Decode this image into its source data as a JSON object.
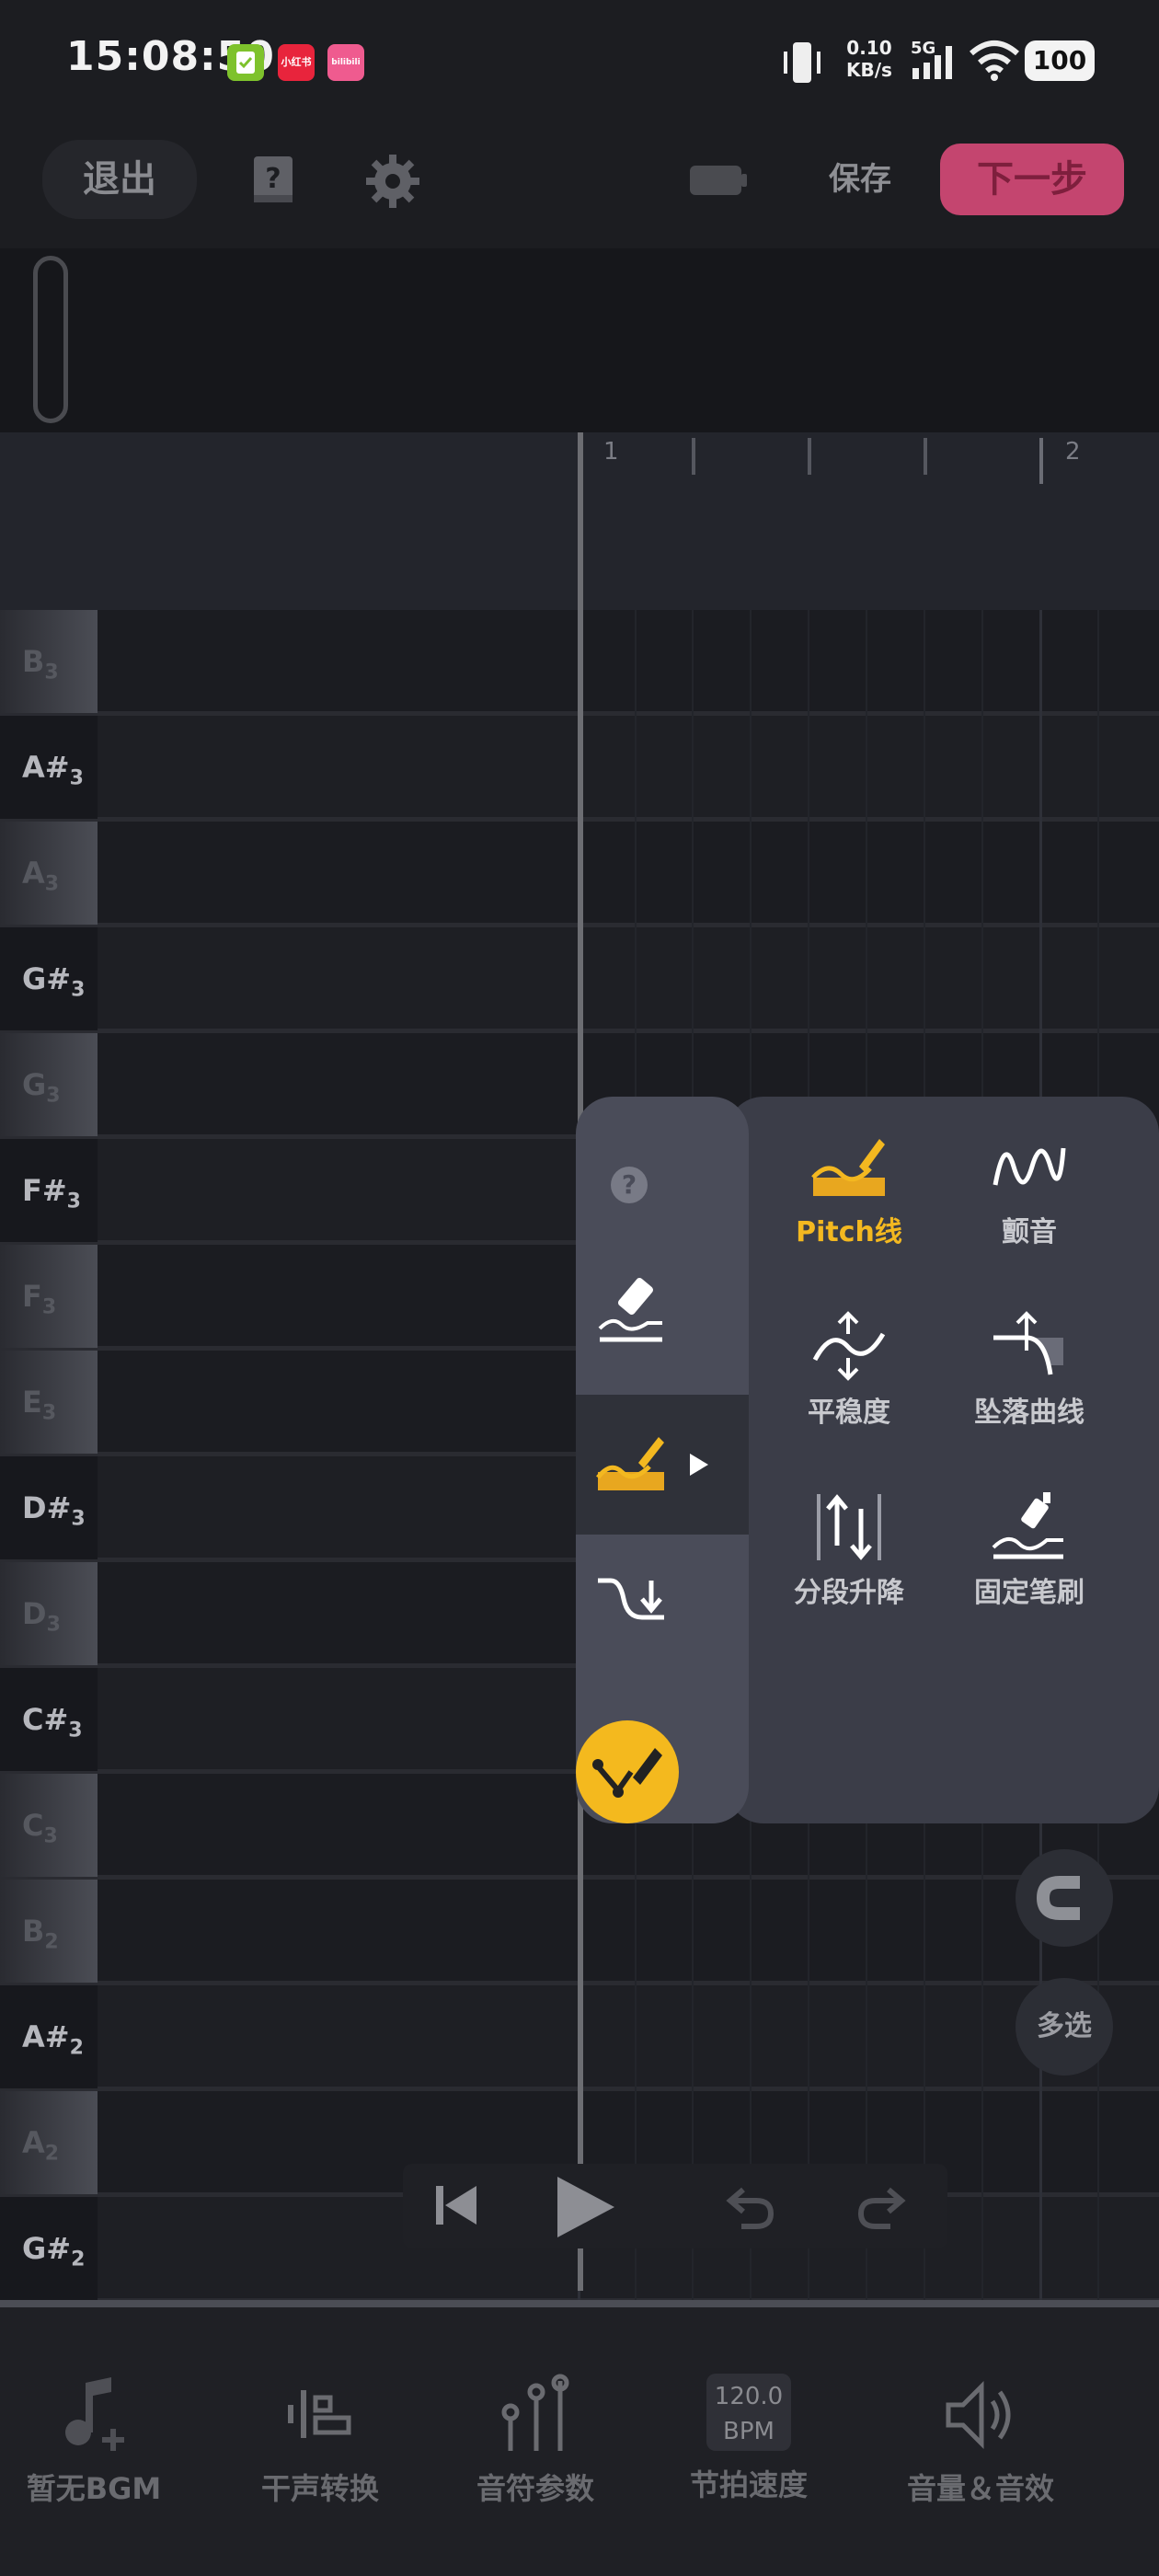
{
  "status_bar": {
    "time": "15:08:50",
    "network_speed_value": "0.10",
    "network_speed_unit": "KB/s",
    "signal_label": "5G",
    "battery": "100",
    "apps": [
      {
        "name": "check-app",
        "label": "",
        "color": "#7ec22c"
      },
      {
        "name": "xiaohongshu",
        "label": "小红书",
        "color": "#e8243c"
      },
      {
        "name": "bilibili",
        "label": "bilibili",
        "color": "#ef5b8f"
      }
    ]
  },
  "toolbar": {
    "exit_label": "退出",
    "save_label": "保存",
    "next_label": "下一步"
  },
  "ruler": {
    "bars": [
      "1",
      "2"
    ]
  },
  "piano_keys": [
    {
      "note": "B",
      "octave": "3",
      "type": "white"
    },
    {
      "note": "A#",
      "octave": "3",
      "type": "black"
    },
    {
      "note": "A",
      "octave": "3",
      "type": "white"
    },
    {
      "note": "G#",
      "octave": "3",
      "type": "black"
    },
    {
      "note": "G",
      "octave": "3",
      "type": "white"
    },
    {
      "note": "F#",
      "octave": "3",
      "type": "black"
    },
    {
      "note": "F",
      "octave": "3",
      "type": "white"
    },
    {
      "note": "E",
      "octave": "3",
      "type": "white"
    },
    {
      "note": "D#",
      "octave": "3",
      "type": "black"
    },
    {
      "note": "D",
      "octave": "3",
      "type": "white"
    },
    {
      "note": "C#",
      "octave": "3",
      "type": "black"
    },
    {
      "note": "C",
      "octave": "3",
      "type": "white"
    },
    {
      "note": "B",
      "octave": "2",
      "type": "white"
    },
    {
      "note": "A#",
      "octave": "2",
      "type": "black"
    },
    {
      "note": "A",
      "octave": "2",
      "type": "white"
    },
    {
      "note": "G#",
      "octave": "2",
      "type": "black"
    }
  ],
  "tool_panel": {
    "help_glyph": "?",
    "tools": [
      {
        "label": "Pitch线",
        "icon": "pitch-line-icon",
        "active": true
      },
      {
        "label": "颤音",
        "icon": "vibrato-icon",
        "active": false
      },
      {
        "label": "平稳度",
        "icon": "smoothness-icon",
        "active": false
      },
      {
        "label": "坠落曲线",
        "icon": "falloff-curve-icon",
        "active": false
      },
      {
        "label": "分段升降",
        "icon": "segment-raise-lower-icon",
        "active": false
      },
      {
        "label": "固定笔刷",
        "icon": "fixed-brush-icon",
        "active": false
      }
    ]
  },
  "multi_select_label": "多选",
  "bottom_nav": {
    "bgm_label": "暂无BGM",
    "voice_label": "干声转换",
    "params_label": "音符参数",
    "tempo_value": "120.0",
    "tempo_unit": "BPM",
    "tempo_label": "节拍速度",
    "volume_label": "音量＆音效"
  },
  "colors": {
    "accent_pink": "#c4456f",
    "accent_yellow": "#f3b820"
  }
}
